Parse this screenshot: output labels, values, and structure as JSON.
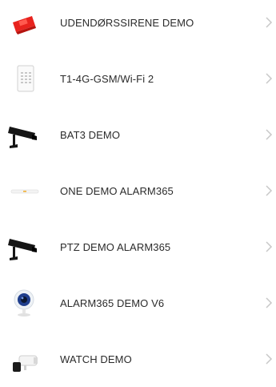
{
  "devices": [
    {
      "name": "UDENDØRSSIRENE DEMO",
      "icon": "siren-icon"
    },
    {
      "name": "T1-4G-GSM/Wi-Fi 2",
      "icon": "keypad-panel-icon"
    },
    {
      "name": "BAT3 DEMO",
      "icon": "bullet-camera-icon"
    },
    {
      "name": "ONE DEMO ALARM365",
      "icon": "alarm-hub-icon"
    },
    {
      "name": "PTZ DEMO ALARM365",
      "icon": "bullet-camera-icon"
    },
    {
      "name": "ALARM365 DEMO V6",
      "icon": "indoor-camera-icon"
    },
    {
      "name": "WATCH DEMO",
      "icon": "outdoor-camera-icon"
    }
  ],
  "colors": {
    "text": "#2b2b2b",
    "chevron": "#c8c8c8",
    "siren_red": "#e8231e"
  }
}
